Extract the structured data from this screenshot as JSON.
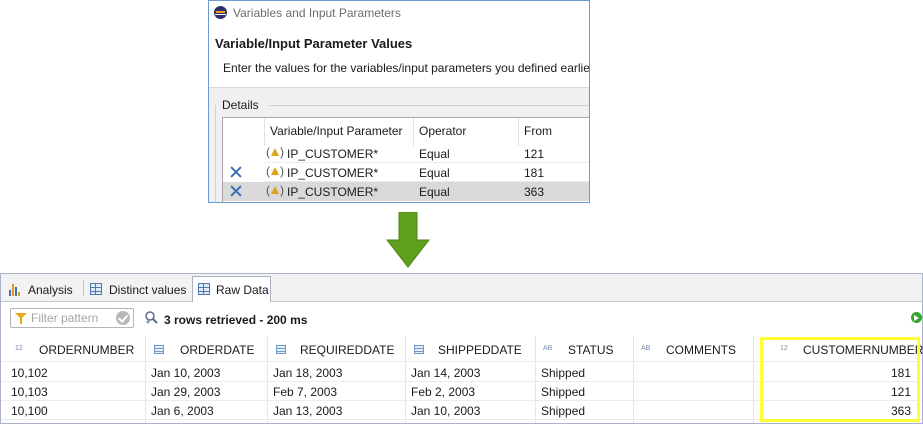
{
  "dialog": {
    "title": "Variables and Input Parameters",
    "heading": "Variable/Input Parameter Values",
    "description": "Enter the values for the variables/input parameters you defined earlier",
    "group_label": "Details",
    "columns": [
      "Variable/Input Parameter",
      "Operator",
      "From"
    ],
    "rows": [
      {
        "removable": false,
        "selected": false,
        "name": "IP_CUSTOMER*",
        "operator": "Equal",
        "from": "121"
      },
      {
        "removable": true,
        "selected": false,
        "name": "IP_CUSTOMER*",
        "operator": "Equal",
        "from": "181"
      },
      {
        "removable": true,
        "selected": true,
        "name": "IP_CUSTOMER*",
        "operator": "Equal",
        "from": "363"
      }
    ],
    "param_icon": "parenthesized-triangle-icon",
    "remove_icon": "remove-x-icon"
  },
  "arrow": {
    "icon": "down-arrow-icon",
    "color": "#5fa01c"
  },
  "results": {
    "tabs": [
      {
        "label": "Analysis",
        "icon": "bar-chart-icon",
        "active": false
      },
      {
        "label": "Distinct values",
        "icon": "table-icon",
        "active": false
      },
      {
        "label": "Raw Data",
        "icon": "grid-icon",
        "active": true
      }
    ],
    "filter_placeholder": "Filter pattern",
    "status": "3 rows retrieved - 200 ms",
    "columns": [
      {
        "type": "12",
        "name": "ORDERNUMBER"
      },
      {
        "type": "date",
        "name": "ORDERDATE"
      },
      {
        "type": "date",
        "name": "REQUIREDDATE"
      },
      {
        "type": "date",
        "name": "SHIPPEDDATE"
      },
      {
        "type": "AB",
        "name": "STATUS"
      },
      {
        "type": "AB",
        "name": "COMMENTS"
      },
      {
        "type": "12",
        "name": "CUSTOMERNUMBER"
      }
    ],
    "rows": [
      [
        "10,102",
        "Jan 10, 2003",
        "Jan 18, 2003",
        "Jan 14, 2003",
        "Shipped",
        "",
        "181"
      ],
      [
        "10,103",
        "Jan 29, 2003",
        "Feb 7, 2003",
        "Feb 2, 2003",
        "Shipped",
        "",
        "121"
      ],
      [
        "10,100",
        "Jan 6, 2003",
        "Jan 13, 2003",
        "Jan 10, 2003",
        "Shipped",
        "",
        "363"
      ]
    ],
    "highlight_color": "#ffff33"
  }
}
